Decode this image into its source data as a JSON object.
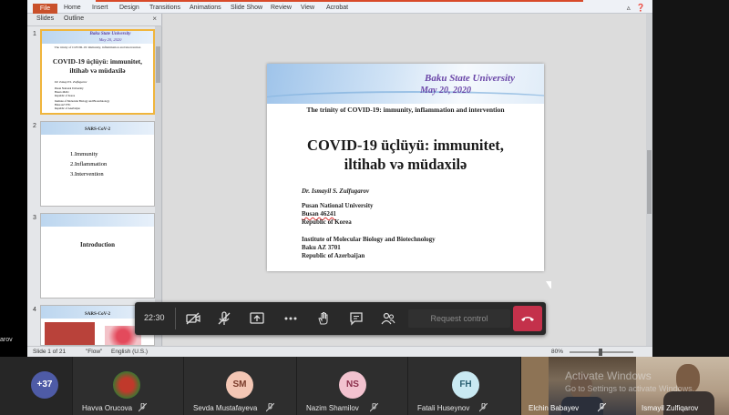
{
  "presenter_cut": "arov",
  "ribbon": {
    "file": "File",
    "tabs": [
      "Home",
      "Insert",
      "Design",
      "Transitions",
      "Animations",
      "Slide Show",
      "Review",
      "View",
      "Acrobat"
    ]
  },
  "panel": {
    "tabs": [
      "Slides",
      "Outline"
    ],
    "close": "×",
    "thumbs": [
      {
        "num": "1",
        "uni": "Baku State University",
        "date": "May 20, 2020",
        "trinity": "The trinity of COVID-19: immunity, inflammation and intervention",
        "title_l1": "COVID-19  üçlüyü: immunitet,",
        "title_l2": "iltihab və müdaxilə",
        "author": "Dr. Ismayil S. Zulfugarov",
        "aff": [
          "Pusan National University",
          "Busan 46241",
          "Republic of Korea",
          "Institute of Molecular Biology and Biotechnology",
          "Baku AZ 3701",
          "Republic of Azerbaijan"
        ]
      },
      {
        "num": "2",
        "head": "SARS-CoV-2",
        "items": [
          "1.Immunity",
          "2.Inflammation",
          "3.Intervention"
        ]
      },
      {
        "num": "3",
        "title": "Introduction"
      },
      {
        "num": "4",
        "head": "SARS-CoV-2"
      }
    ]
  },
  "slide": {
    "university": "Baku State University",
    "date": "May 20, 2020",
    "trinity": "The trinity of COVID-19: immunity, inflammation and intervention",
    "title_line1": "COVID-19 üçlüyü: immunitet,",
    "title_line2": "iltihab və müdaxilə",
    "author": "Dr. Ismayil S. Zulfugarov",
    "affiliation1": [
      "Pusan National University",
      "Busan 46241",
      "Republic of Korea"
    ],
    "affiliation2": [
      "Institute of Molecular Biology and Biotechnology",
      "Baku AZ 3701",
      "Republic of Azerbaijan"
    ]
  },
  "status": {
    "slide": "Slide 1 of 21",
    "theme": "\"Flow\"",
    "lang": "English (U.S.)",
    "zoom": "80%"
  },
  "toolbar": {
    "time": "22:30",
    "request": "Request control",
    "icons": [
      "camera-off-icon",
      "mic-off-icon",
      "share-screen-icon",
      "more-icon",
      "raise-hand-icon",
      "chat-icon",
      "participants-icon",
      "hang-up-icon"
    ]
  },
  "participants": {
    "overflow": "+37",
    "people": [
      {
        "name": "Havva Orucova",
        "initials": ""
      },
      {
        "name": "Sevda Mustafayeva",
        "initials": "SM"
      },
      {
        "name": "Nazim Shamilov",
        "initials": "NS"
      },
      {
        "name": "Fatali Huseynov",
        "initials": "FH"
      },
      {
        "name": "Elchin Babayev",
        "initials": ""
      },
      {
        "name": "Ismayil Zulfiqarov",
        "initials": ""
      }
    ]
  },
  "watermark": {
    "line1": "Activate Windows",
    "line2": "Go to Settings to activate Windows."
  },
  "colors": {
    "hangup": "#c4314b",
    "accent_purple": "#6b47a8",
    "file_tab": "#c9502a"
  }
}
